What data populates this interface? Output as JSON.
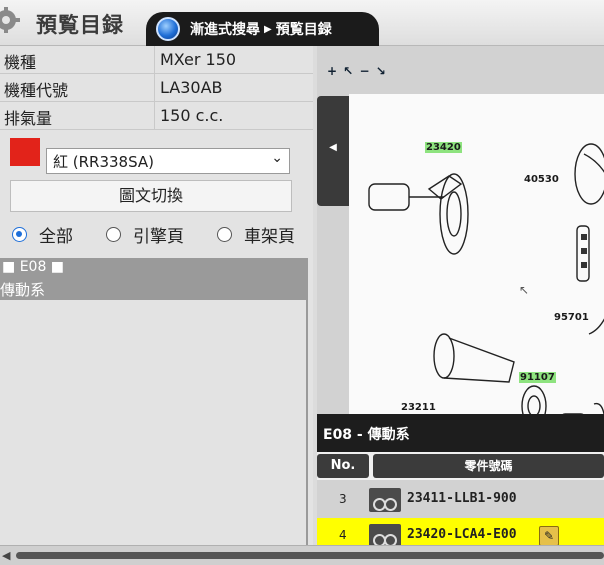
{
  "header": {
    "title": "預覧目録",
    "breadcrumb": [
      "漸進式搜尋",
      "預覧目録"
    ]
  },
  "vehicle": {
    "rows": [
      {
        "label": "機種",
        "value": "MXer 150"
      },
      {
        "label": "機種代號",
        "value": "LA30AB"
      },
      {
        "label": "排氣量",
        "value": "150 c.c."
      }
    ],
    "color_swatch": "#e2231a",
    "color_value": "紅 (RR338SA)"
  },
  "toggle_label": "圖文切換",
  "filters": {
    "options": [
      "全部",
      "引擎頁",
      "車架頁"
    ],
    "selected": "全部"
  },
  "group": {
    "code": "E08",
    "name": "傳動系"
  },
  "diagram": {
    "toolbar": "+ ↖ − ↘",
    "callouts": [
      "23420",
      "40530",
      "23211",
      "91107",
      "95701"
    ]
  },
  "parts_panel": {
    "title": "E08 - 傳動系",
    "headers": {
      "no": "No.",
      "part_number": "零件號碼"
    },
    "rows": [
      {
        "no": "3",
        "part_number": "23411-LLB1-900",
        "highlighted": false
      },
      {
        "no": "4",
        "part_number": "23420-LCA4-E00",
        "highlighted": true
      }
    ],
    "highlight_color": "#ffff00"
  }
}
